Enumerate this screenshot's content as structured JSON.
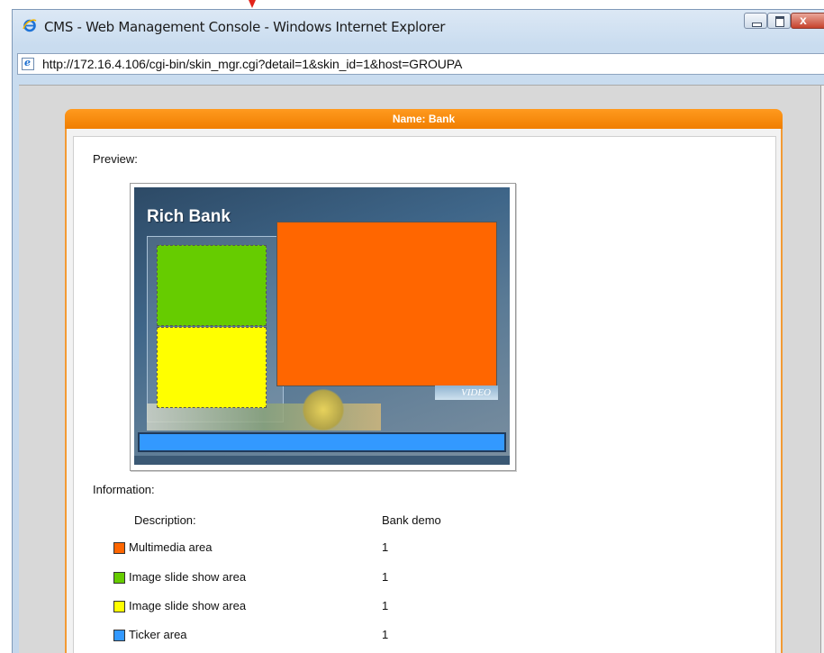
{
  "window": {
    "title": "CMS - Web Management Console - Windows Internet Explorer",
    "url": "http://172.16.4.106/cgi-bin/skin_mgr.cgi?detail=1&skin_id=1&host=GROUPA",
    "close_symbol": "x"
  },
  "icons": {
    "browser": "ie-logo-icon",
    "page": "page-e-icon",
    "minimize": "minimize-icon",
    "maximize": "maximize-icon",
    "close": "close-icon"
  },
  "card": {
    "header": "Name: Bank",
    "preview_label": "Preview:",
    "information_label": "Information:"
  },
  "preview": {
    "skin_title": "Rich Bank",
    "video_tab": "VIDEO"
  },
  "info": {
    "description_label": "Description:",
    "description_value": "Bank demo",
    "rows": [
      {
        "label": "Multimedia area",
        "value": "1",
        "color": "#ff6600"
      },
      {
        "label": "Image slide show area",
        "value": "1",
        "color": "#66cc00"
      },
      {
        "label": "Image slide show area",
        "value": "1",
        "color": "#ffff00"
      },
      {
        "label": "Ticker area",
        "value": "1",
        "color": "#3399ff"
      }
    ]
  },
  "colors": {
    "header_orange": "#f08000",
    "multimedia": "#ff6600",
    "slideshow_green": "#66cc00",
    "slideshow_yellow": "#ffff00",
    "ticker": "#3399ff"
  }
}
